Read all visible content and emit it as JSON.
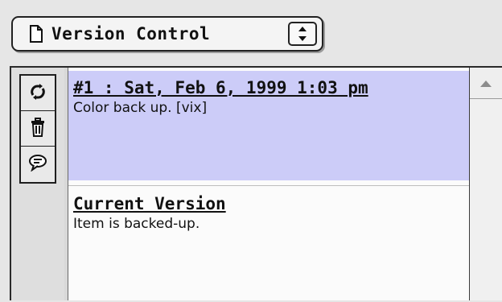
{
  "popup": {
    "label": "Version Control",
    "icon": "document-icon",
    "arrows_icon": "up-down-arrows-icon"
  },
  "toolbar": {
    "tools": [
      {
        "icon": "refresh-icon"
      },
      {
        "icon": "trash-icon"
      },
      {
        "icon": "comment-bubble-icon"
      }
    ]
  },
  "entries": [
    {
      "title": "#1 : Sat, Feb 6, 1999 1:03 pm",
      "description": "Color back up. [vix]",
      "selected": true
    },
    {
      "title": "Current Version",
      "description": "Item is backed-up.",
      "selected": false
    }
  ],
  "scrollbar": {
    "up_icon": "scroll-up-arrow-icon"
  },
  "colors": {
    "selection": "#ccccf8",
    "background": "#e6e6e6"
  }
}
